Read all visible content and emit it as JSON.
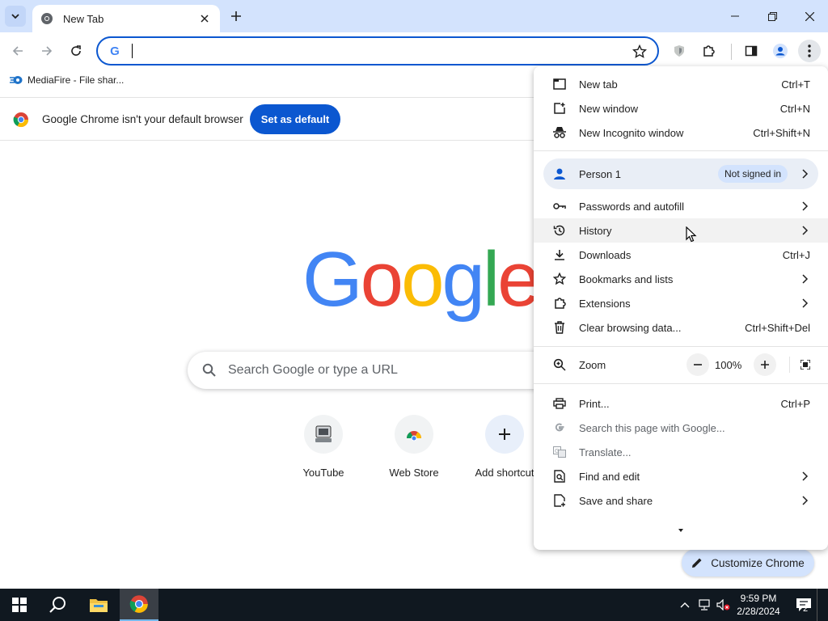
{
  "tab": {
    "title": "New Tab"
  },
  "bookmarks": {
    "items": [
      {
        "label": "MediaFire - File shar..."
      }
    ]
  },
  "infobar": {
    "message": "Google Chrome isn't your default browser",
    "button_label": "Set as default"
  },
  "ntp": {
    "logo_letters": [
      "G",
      "o",
      "o",
      "g",
      "l",
      "e"
    ],
    "logo_colors": [
      "#4285f4",
      "#ea4335",
      "#fbbc05",
      "#4285f4",
      "#34a853",
      "#ea4335"
    ],
    "search_placeholder": "Search Google or type a URL",
    "shortcuts": [
      {
        "label": "YouTube",
        "icon": "youtube-icon"
      },
      {
        "label": "Web Store",
        "icon": "webstore-icon"
      },
      {
        "label": "Add shortcut",
        "icon": "plus-icon"
      }
    ],
    "customize_label": "Customize Chrome"
  },
  "menu": {
    "new_tab": {
      "label": "New tab",
      "shortcut": "Ctrl+T"
    },
    "new_window": {
      "label": "New window",
      "shortcut": "Ctrl+N"
    },
    "incognito": {
      "label": "New Incognito window",
      "shortcut": "Ctrl+Shift+N"
    },
    "person": {
      "label": "Person 1",
      "status": "Not signed in"
    },
    "passwords": {
      "label": "Passwords and autofill"
    },
    "history": {
      "label": "History"
    },
    "downloads": {
      "label": "Downloads",
      "shortcut": "Ctrl+J"
    },
    "bookmarks": {
      "label": "Bookmarks and lists"
    },
    "extensions": {
      "label": "Extensions"
    },
    "clear_data": {
      "label": "Clear browsing data...",
      "shortcut": "Ctrl+Shift+Del"
    },
    "zoom": {
      "label": "Zoom",
      "value": "100%"
    },
    "print": {
      "label": "Print...",
      "shortcut": "Ctrl+P"
    },
    "search_page": {
      "label": "Search this page with Google..."
    },
    "translate": {
      "label": "Translate..."
    },
    "find_edit": {
      "label": "Find and edit"
    },
    "save_share": {
      "label": "Save and share"
    }
  },
  "taskbar": {
    "time": "9:59 PM",
    "date": "2/28/2024",
    "notification_count": "2"
  },
  "colors": {
    "accent": "#0b57d0",
    "tabstrip": "#d3e3fd",
    "taskbar": "#101820"
  }
}
